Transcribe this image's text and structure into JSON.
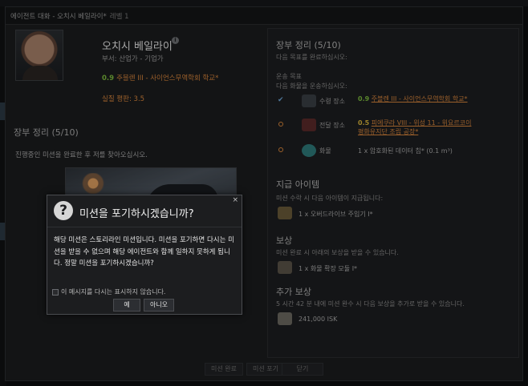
{
  "window": {
    "title": "에이전트 대화 - 오치시 베일라이*",
    "level": "레벨 1"
  },
  "agent": {
    "name": "오치시 베일라이",
    "department": "부서: 산업가 - 기업가",
    "security": "0.9",
    "location": "주블렌 III - 사이언스무역학회 학교*",
    "rating": "실질 평판: 3.5"
  },
  "left": {
    "title": "장부 정리 (5/10)",
    "description": "진행중인 미션을 완료한 후 저를 찾아오십시오."
  },
  "right": {
    "title": "장부 정리 (5/10)",
    "subtitle": "다음 목표를 완료하십시오:",
    "transport_heading": "운송 목표",
    "transport_sub": "다음 화물을 운송하십시오:",
    "pickup": {
      "label": "수령 장소",
      "security": "0.9",
      "location": "주블렌 III - 사이언스무역학회 학교*"
    },
    "dropoff": {
      "label": "전달 장소",
      "security": "0.5",
      "location": "피에쿠라 VIII - 위성 11 - 위요르코이 평화유지단 조립 공장*"
    },
    "cargo": {
      "label": "화물",
      "value": "1 x 암호화된 데이터 칩* (0.1 m³)"
    },
    "granted_title": "지급 아이템",
    "granted_sub": "미션 수락 시 다음 아이템이 지급됩니다:",
    "granted_item": "1 x 오버드라이브 주입기 I*",
    "reward_title": "보상",
    "reward_sub": "미션 완료 시 아래의 보상을 받을 수 있습니다.",
    "reward_item": "1 x 화물 확장 모듈 I*",
    "bonus_title": "추가 보상",
    "bonus_sub": "5 시간 42 분 내에 미션 완수 시 다음 보상을 추가로 받을 수 있습니다.",
    "bonus_item": "241,000 ISK"
  },
  "bottom": {
    "complete": "미션 완료",
    "quit": "미션 포기",
    "close": "닫기"
  },
  "modal": {
    "title": "미션을 포기하시겠습니까?",
    "close": "×",
    "body": "해당 미션은 스토리라인 미션입니다. 미션을 포기하면 다시는 미션을 받을 수 없으며 해당 에이전트와 함께 일하지 못하게 됩니다. 정말 미션을 포기하시겠습니까?",
    "dont_show": "이 메시지를 다시는 표시하지 않습니다.",
    "yes": "예",
    "no": "아니오"
  },
  "colors": {
    "accent_orange": "#d8863c",
    "security_green": "#7dbb3e",
    "security_yellow": "#d8b43c"
  },
  "icons": [
    "info-icon",
    "question-icon",
    "check-icon",
    "ring-icon",
    "station-icon",
    "datachip-icon",
    "module-icon",
    "isk-icon",
    "close-icon"
  ]
}
